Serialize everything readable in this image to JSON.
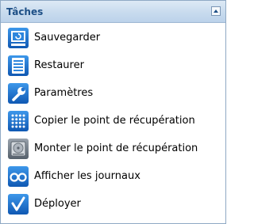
{
  "panel": {
    "title": "Tâches",
    "collapse_icon": "triangle-up-icon"
  },
  "tasks": [
    {
      "label": "Sauvegarder",
      "icon": "backup-icon"
    },
    {
      "label": "Restaurer",
      "icon": "restore-icon"
    },
    {
      "label": "Paramètres",
      "icon": "wrench-icon"
    },
    {
      "label": "Copier le point de récupération",
      "icon": "grid-dots-icon"
    },
    {
      "label": "Monter le point de récupération",
      "icon": "hard-disk-icon"
    },
    {
      "label": "Afficher les journaux",
      "icon": "glasses-icon"
    },
    {
      "label": "Déployer",
      "icon": "checkmark-icon"
    }
  ],
  "colors": {
    "icon_blue": "#1b6fd0",
    "title": "#1d4f86"
  }
}
